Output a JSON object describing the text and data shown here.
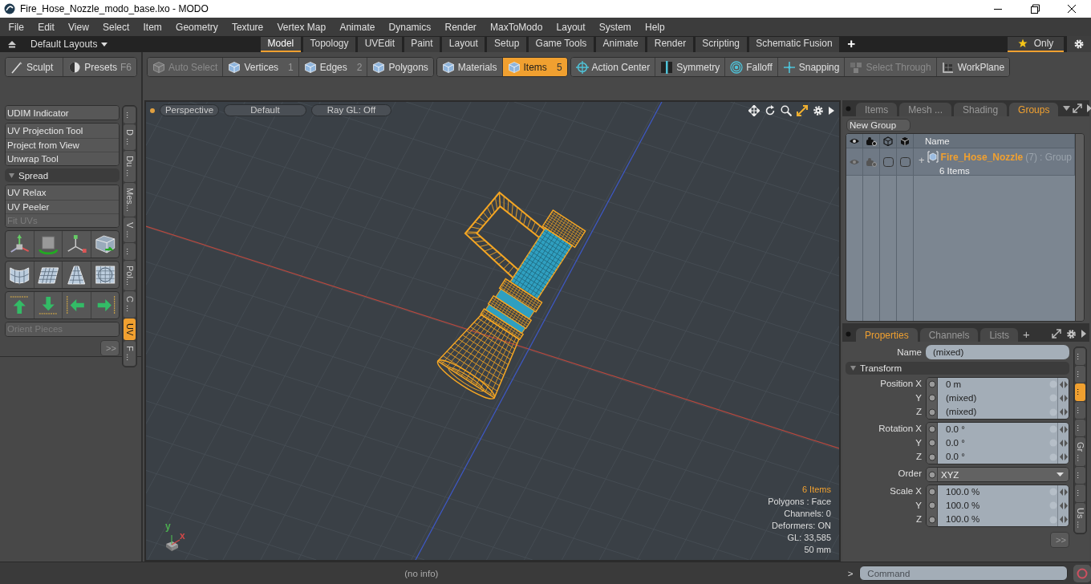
{
  "window": {
    "title": "Fire_Hose_Nozzle_modo_base.lxo - MODO"
  },
  "menu": [
    "File",
    "Edit",
    "View",
    "Select",
    "Item",
    "Geometry",
    "Texture",
    "Vertex Map",
    "Animate",
    "Dynamics",
    "Render",
    "MaxToModo",
    "Layout",
    "System",
    "Help"
  ],
  "layout_bar": {
    "preset": "Default Layouts",
    "tabs": [
      {
        "label": "Model",
        "selected": true
      },
      {
        "label": "Topology",
        "selected": false
      },
      {
        "label": "UVEdit",
        "selected": false
      },
      {
        "label": "Paint",
        "selected": false
      },
      {
        "label": "Layout",
        "selected": false
      },
      {
        "label": "Setup",
        "selected": false
      },
      {
        "label": "Game Tools",
        "selected": false
      },
      {
        "label": "Animate",
        "selected": false
      },
      {
        "label": "Render",
        "selected": false
      },
      {
        "label": "Scripting",
        "selected": false
      },
      {
        "label": "Schematic Fusion",
        "selected": false
      }
    ],
    "add": "+",
    "filter": {
      "label": "Only",
      "selected": true
    }
  },
  "toolbar": {
    "tools": [
      {
        "label": "Sculpt"
      },
      {
        "label": "Presets",
        "shortcut": "F6"
      }
    ],
    "groups": [
      {
        "items": [
          {
            "label": "Auto Select",
            "disabled": true,
            "selected": false
          },
          {
            "label": "Vertices",
            "shortcut": "1",
            "disabled": false,
            "selected": false
          },
          {
            "label": "Edges",
            "shortcut": "2",
            "disabled": false,
            "selected": false
          },
          {
            "label": "Polygons",
            "disabled": false,
            "selected": false
          }
        ]
      },
      {
        "items": [
          {
            "label": "Materials",
            "disabled": false,
            "selected": false
          },
          {
            "label": "Items",
            "shortcut": "5",
            "disabled": false,
            "selected": true
          }
        ]
      },
      {
        "items": [
          {
            "label": "Action Center",
            "disabled": false,
            "selected": false
          },
          {
            "label": "Symmetry",
            "disabled": false,
            "selected": false
          },
          {
            "label": "Falloff",
            "disabled": false,
            "selected": false
          },
          {
            "label": "Snapping",
            "disabled": false,
            "selected": false
          },
          {
            "label": "Select Through",
            "disabled": true,
            "selected": false
          },
          {
            "label": "WorkPlane",
            "disabled": false,
            "selected": false
          }
        ]
      }
    ]
  },
  "left_panel": {
    "groups": [
      {
        "items": [
          {
            "label": "UDIM Indicator",
            "disabled": false
          }
        ]
      },
      {
        "items": [
          {
            "label": "UV Projection Tool",
            "disabled": false
          },
          {
            "label": "Project from View",
            "disabled": false
          },
          {
            "label": "Unwrap Tool",
            "disabled": false
          }
        ]
      },
      {
        "items": [
          {
            "label": "UV Relax",
            "disabled": false
          },
          {
            "label": "UV Peeler",
            "disabled": false
          },
          {
            "label": "Fit UVs",
            "disabled": true
          }
        ]
      }
    ],
    "section": "Spread",
    "bottom": [
      {
        "label": "Orient Pieces",
        "disabled": true
      }
    ],
    "more": ">>",
    "side_tabs": [
      {
        "label": "...",
        "selected": false
      },
      {
        "label": "D ...",
        "selected": false
      },
      {
        "label": "Du ...",
        "selected": false
      },
      {
        "label": "Mes...",
        "selected": false
      },
      {
        "label": "V ...",
        "selected": false
      },
      {
        "label": "...",
        "selected": false
      },
      {
        "label": "Pol...",
        "selected": false
      },
      {
        "label": "C ...",
        "selected": false
      },
      {
        "label": "UV",
        "selected": true
      },
      {
        "label": "F ...",
        "selected": false
      }
    ]
  },
  "viewport": {
    "buttons": [
      "Perspective",
      "Default",
      "Ray GL: Off"
    ],
    "stats": [
      {
        "text": "6 Items",
        "kind": "highlight"
      },
      {
        "text": "Polygons : Face",
        "kind": "plain"
      },
      {
        "text": "Channels: 0",
        "kind": "plain"
      },
      {
        "text": "Deformers: ON",
        "kind": "plain"
      },
      {
        "text": "GL: 33,585",
        "kind": "plain"
      },
      {
        "text": "50 mm",
        "kind": "plain"
      }
    ],
    "axes": [
      {
        "label": "y",
        "color": "#4caf50"
      },
      {
        "label": "x",
        "color": "#d04848"
      }
    ]
  },
  "groups_panel": {
    "tabs": [
      {
        "label": "Items",
        "selected": false
      },
      {
        "label": "Mesh ...",
        "selected": false
      },
      {
        "label": "Shading",
        "selected": false
      },
      {
        "label": "Groups",
        "selected": true
      }
    ],
    "new_button": "New Group",
    "column": "Name",
    "rows": [
      {
        "expander": "+",
        "name": "Fire_Hose_Nozzle",
        "count": "(7)",
        "type": ": Group",
        "detail": "6 Items"
      }
    ]
  },
  "properties": {
    "tabs": [
      {
        "label": "Properties",
        "selected": true
      },
      {
        "label": "Channels",
        "selected": false
      },
      {
        "label": "Lists",
        "selected": false
      }
    ],
    "add": "+",
    "name_label": "Name",
    "name_value": "(mixed)",
    "section": "Transform",
    "blocks": [
      {
        "kind": "fields",
        "rows": [
          {
            "label": "Position X",
            "value": "0 m"
          },
          {
            "label": "Y",
            "value": "(mixed)"
          },
          {
            "label": "Z",
            "value": "(mixed)"
          }
        ]
      },
      {
        "kind": "fields",
        "rows": [
          {
            "label": "Rotation X",
            "value": "0.0 °"
          },
          {
            "label": "Y",
            "value": "0.0 °"
          },
          {
            "label": "Z",
            "value": "0.0 °"
          }
        ]
      },
      {
        "kind": "dropdown",
        "rows": [
          {
            "label": "Order",
            "value": "XYZ"
          }
        ]
      },
      {
        "kind": "fields",
        "rows": [
          {
            "label": "Scale X",
            "value": "100.0 %"
          },
          {
            "label": "Y",
            "value": "100.0 %"
          },
          {
            "label": "Z",
            "value": "100.0 %"
          }
        ]
      }
    ],
    "more": ">>",
    "side_tabs": [
      {
        "label": "...",
        "selected": false
      },
      {
        "label": "...",
        "selected": false
      },
      {
        "label": "...",
        "selected": true
      },
      {
        "label": "...",
        "selected": false
      },
      {
        "label": "...",
        "selected": false
      },
      {
        "label": "Gr ...",
        "selected": false
      },
      {
        "label": "...",
        "selected": false
      },
      {
        "label": "...",
        "selected": false
      },
      {
        "label": "Us ...",
        "selected": false
      }
    ]
  },
  "status_bar": {
    "info": "(no info)",
    "prompt": ">",
    "command_placeholder": "Command"
  }
}
